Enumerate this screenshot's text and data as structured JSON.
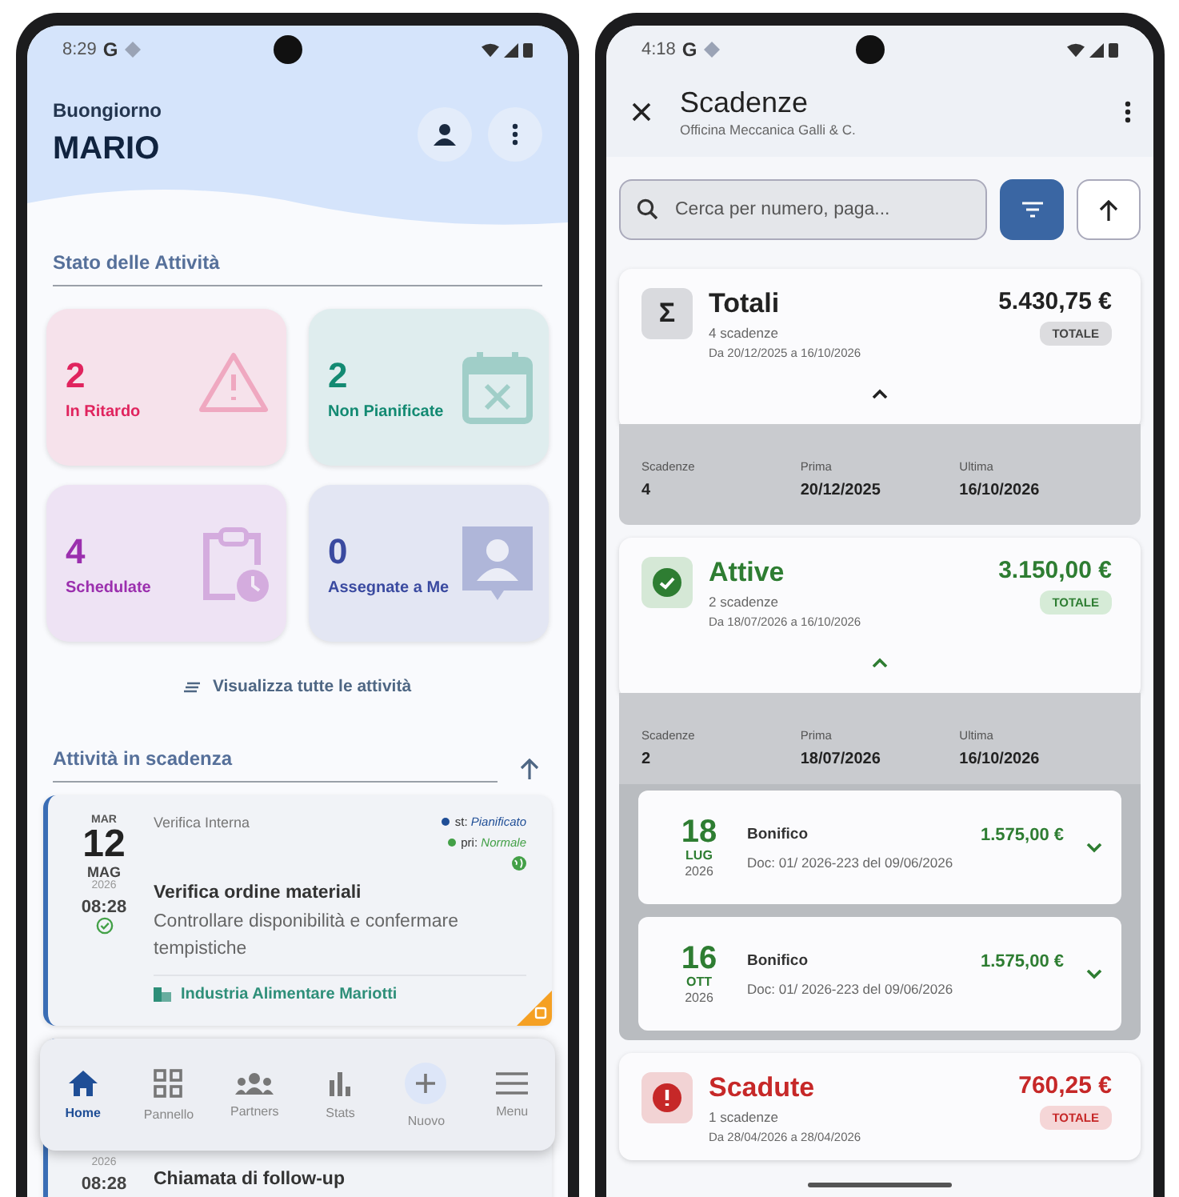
{
  "home_screen": {
    "status_bar": {
      "time": "8:29",
      "carrier": "G"
    },
    "greeting": "Buongiorno",
    "user_name": "MARIO",
    "status_section": {
      "title": "Stato delle Attività",
      "view_all_link": "Visualizza tutte le attività",
      "cards": [
        {
          "value": "2",
          "label": "In Ritardo",
          "color": "#e0245e",
          "kind": "warning"
        },
        {
          "value": "2",
          "label": "Non Pianificate",
          "color": "#138a72",
          "kind": "calendar"
        },
        {
          "value": "4",
          "label": "Schedulate",
          "color": "#9b2fae",
          "kind": "clipboard"
        },
        {
          "value": "0",
          "label": "Assegnate a Me",
          "color": "#3a4aa0",
          "kind": "person"
        }
      ]
    },
    "due_section": {
      "title": "Attività in scadenza",
      "activities": [
        {
          "weekday": "MAR",
          "day": "12",
          "month": "MAG",
          "year": "2026",
          "time": "08:28",
          "completed": true,
          "type": "Verifica Interna",
          "status": {
            "label": "st:",
            "value": "Pianificato",
            "color": "#1f4e96"
          },
          "priority": {
            "label": "pri:",
            "value": "Normale",
            "color": "#43a047"
          },
          "title": "Verifica ordine materiali",
          "description": "Controllare disponibilità e confermare tempistiche",
          "company": "Industria Alimentare Mariotti"
        },
        {
          "year": "2026",
          "time": "08:28",
          "title": "Chiamata di follow-up"
        }
      ]
    },
    "bottom_nav": [
      {
        "label": "Home",
        "kind": "home",
        "selected": true
      },
      {
        "label": "Pannello",
        "kind": "dashboard",
        "selected": false
      },
      {
        "label": "Partners",
        "kind": "group",
        "selected": false
      },
      {
        "label": "Stats",
        "kind": "chart",
        "selected": false
      },
      {
        "label": "Nuovo",
        "kind": "add",
        "selected": false
      },
      {
        "label": "Menu",
        "kind": "menu",
        "selected": false
      }
    ]
  },
  "deadlines_screen": {
    "status_bar": {
      "time": "4:18",
      "carrier": "G"
    },
    "title": "Scadenze",
    "subtitle": "Officina Meccanica Galli & C.",
    "search": {
      "placeholder": "Cerca per numero, paga..."
    },
    "groups": [
      {
        "kind": "total",
        "symbol": "Σ",
        "title": "Totali",
        "count": "4 scadenze",
        "range": "Da 20/12/2025 a 16/10/2026",
        "amount": "5.430,75 €",
        "badge": "TOTALE",
        "expanded": true,
        "summary": [
          {
            "label": "Scadenze",
            "value": "4"
          },
          {
            "label": "Prima",
            "value": "20/12/2025"
          },
          {
            "label": "Ultima",
            "value": "16/10/2026"
          }
        ]
      },
      {
        "kind": "active",
        "title": "Attive",
        "count": "2 scadenze",
        "range": "Da 18/07/2026 a 16/10/2026",
        "amount": "3.150,00 €",
        "badge": "TOTALE",
        "expanded": true,
        "summary": [
          {
            "label": "Scadenze",
            "value": "2"
          },
          {
            "label": "Prima",
            "value": "18/07/2026"
          },
          {
            "label": "Ultima",
            "value": "16/10/2026"
          }
        ],
        "items": [
          {
            "day": "18",
            "month": "LUG",
            "year": "2026",
            "method": "Bonifico",
            "amount": "1.575,00 €",
            "document": "Doc: 01/ 2026-223 del 09/06/2026"
          },
          {
            "day": "16",
            "month": "OTT",
            "year": "2026",
            "method": "Bonifico",
            "amount": "1.575,00 €",
            "document": "Doc: 01/ 2026-223 del 09/06/2026"
          }
        ]
      },
      {
        "kind": "overdue",
        "title": "Scadute",
        "count": "1 scadenze",
        "range": "Da 28/04/2026 a 28/04/2026",
        "amount": "760,25 €",
        "badge": "TOTALE",
        "expanded": false
      }
    ]
  }
}
